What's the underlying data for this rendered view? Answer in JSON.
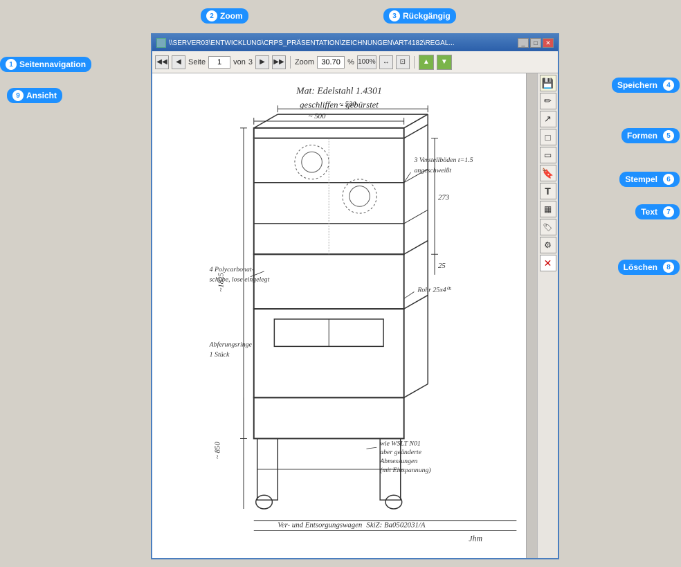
{
  "window": {
    "title": "\\\\SERVER03\\ENTWICKLUNG\\CRPS_PRÄSENTATION\\ZEICHNUNGEN\\ART4182\\REGAL...",
    "page_label": "Seite",
    "page_current": "1",
    "von_label": "von",
    "page_total": "3",
    "zoom_label": "Zoom",
    "zoom_value": "30.70",
    "zoom_percent": "%",
    "zoom_100": "100%"
  },
  "labels": {
    "zoom": "Zoom",
    "rueckgaengig": "Rückgängig",
    "seitennavigation": "Seitennavigation",
    "ansicht": "Ansicht",
    "speichern": "Speichern",
    "formen": "Formen",
    "stempel": "Stempel",
    "text": "Text",
    "loeschen": "Löschen"
  },
  "badges": {
    "zoom_num": "2",
    "rueckgaengig_num": "3",
    "seitennavigation_num": "1",
    "ansicht_num": "9",
    "speichern_num": "4",
    "formen_num": "5",
    "stempel_num": "6",
    "text_num": "7",
    "loeschen_num": "8"
  },
  "toolbar": {
    "first_page": "◀◀",
    "prev_page": "◀",
    "next_page": "▶",
    "last_page": "▶▶",
    "fit_width": "↔",
    "fit_page": "⊡"
  },
  "sidebar_icons": {
    "save": "💾",
    "pen": "✏",
    "select": "↗",
    "rect": "□",
    "rect2": "▭",
    "stamp": "🔖",
    "text": "T",
    "grid": "▦",
    "label": "🏷",
    "tool": "🔧",
    "delete": "✕"
  }
}
